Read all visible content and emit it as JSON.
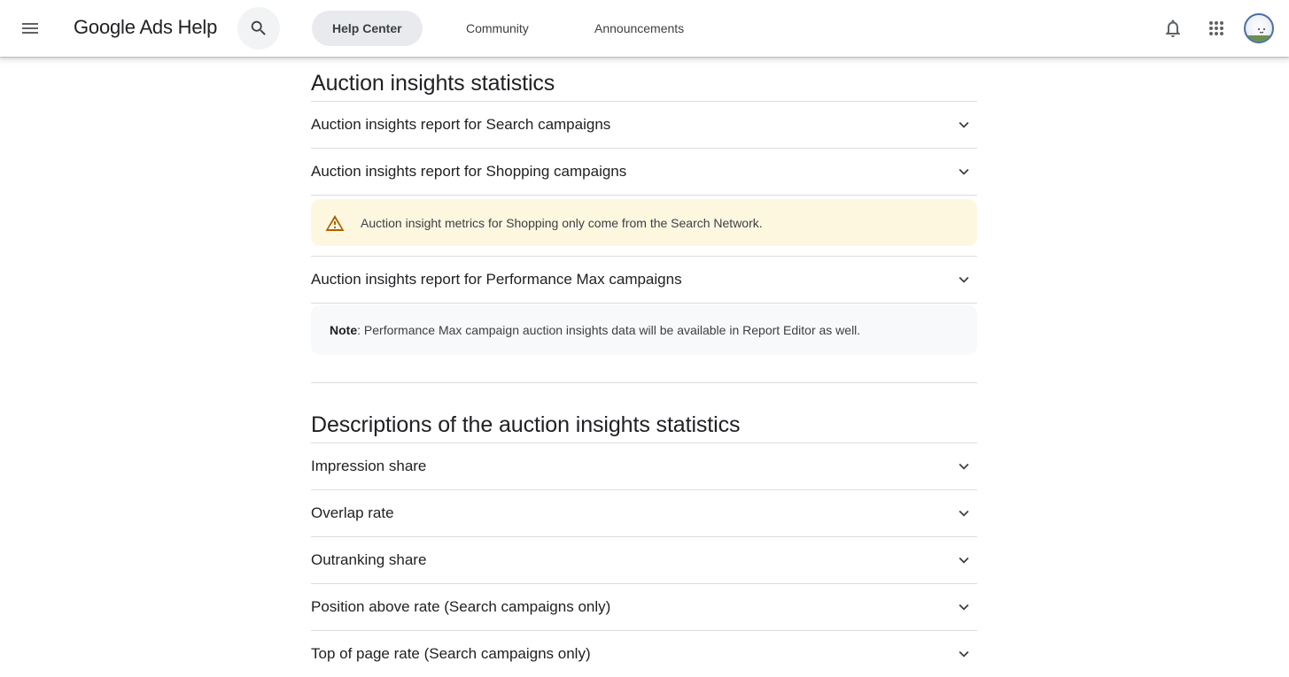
{
  "header": {
    "menu_icon": "menu-icon",
    "brand": "Google Ads Help",
    "search_icon": "search-icon",
    "tabs": [
      {
        "label": "Help Center",
        "active": true
      },
      {
        "label": "Community",
        "active": false
      },
      {
        "label": "Announcements",
        "active": false
      }
    ],
    "notifications_icon": "bell-icon",
    "apps_icon": "apps-grid-icon",
    "avatar_icon": "account-avatar"
  },
  "sections": [
    {
      "title": "Auction insights statistics",
      "items": [
        {
          "label": "Auction insights report for Search campaigns"
        },
        {
          "label": "Auction insights report for Shopping campaigns"
        },
        {
          "label": "Auction insights report for Performance Max campaigns"
        }
      ],
      "warning": "Auction insight metrics for Shopping only come from the Search Network.",
      "note": {
        "prefix": "Note",
        "text": ": Performance Max campaign auction insights data will be available in Report Editor as well."
      }
    },
    {
      "title": "Descriptions of the auction insights statistics",
      "items": [
        {
          "label": "Impression share"
        },
        {
          "label": "Overlap rate"
        },
        {
          "label": "Outranking share"
        },
        {
          "label": "Position above rate (Search campaigns only)"
        },
        {
          "label": "Top of page rate (Search campaigns only)"
        }
      ]
    }
  ],
  "colors": {
    "warning_bg": "#fef7e0",
    "warning_icon": "#b06000",
    "note_bg": "#f8f9fa",
    "active_tab_bg": "#e8eaed",
    "divider": "#dadce0"
  }
}
